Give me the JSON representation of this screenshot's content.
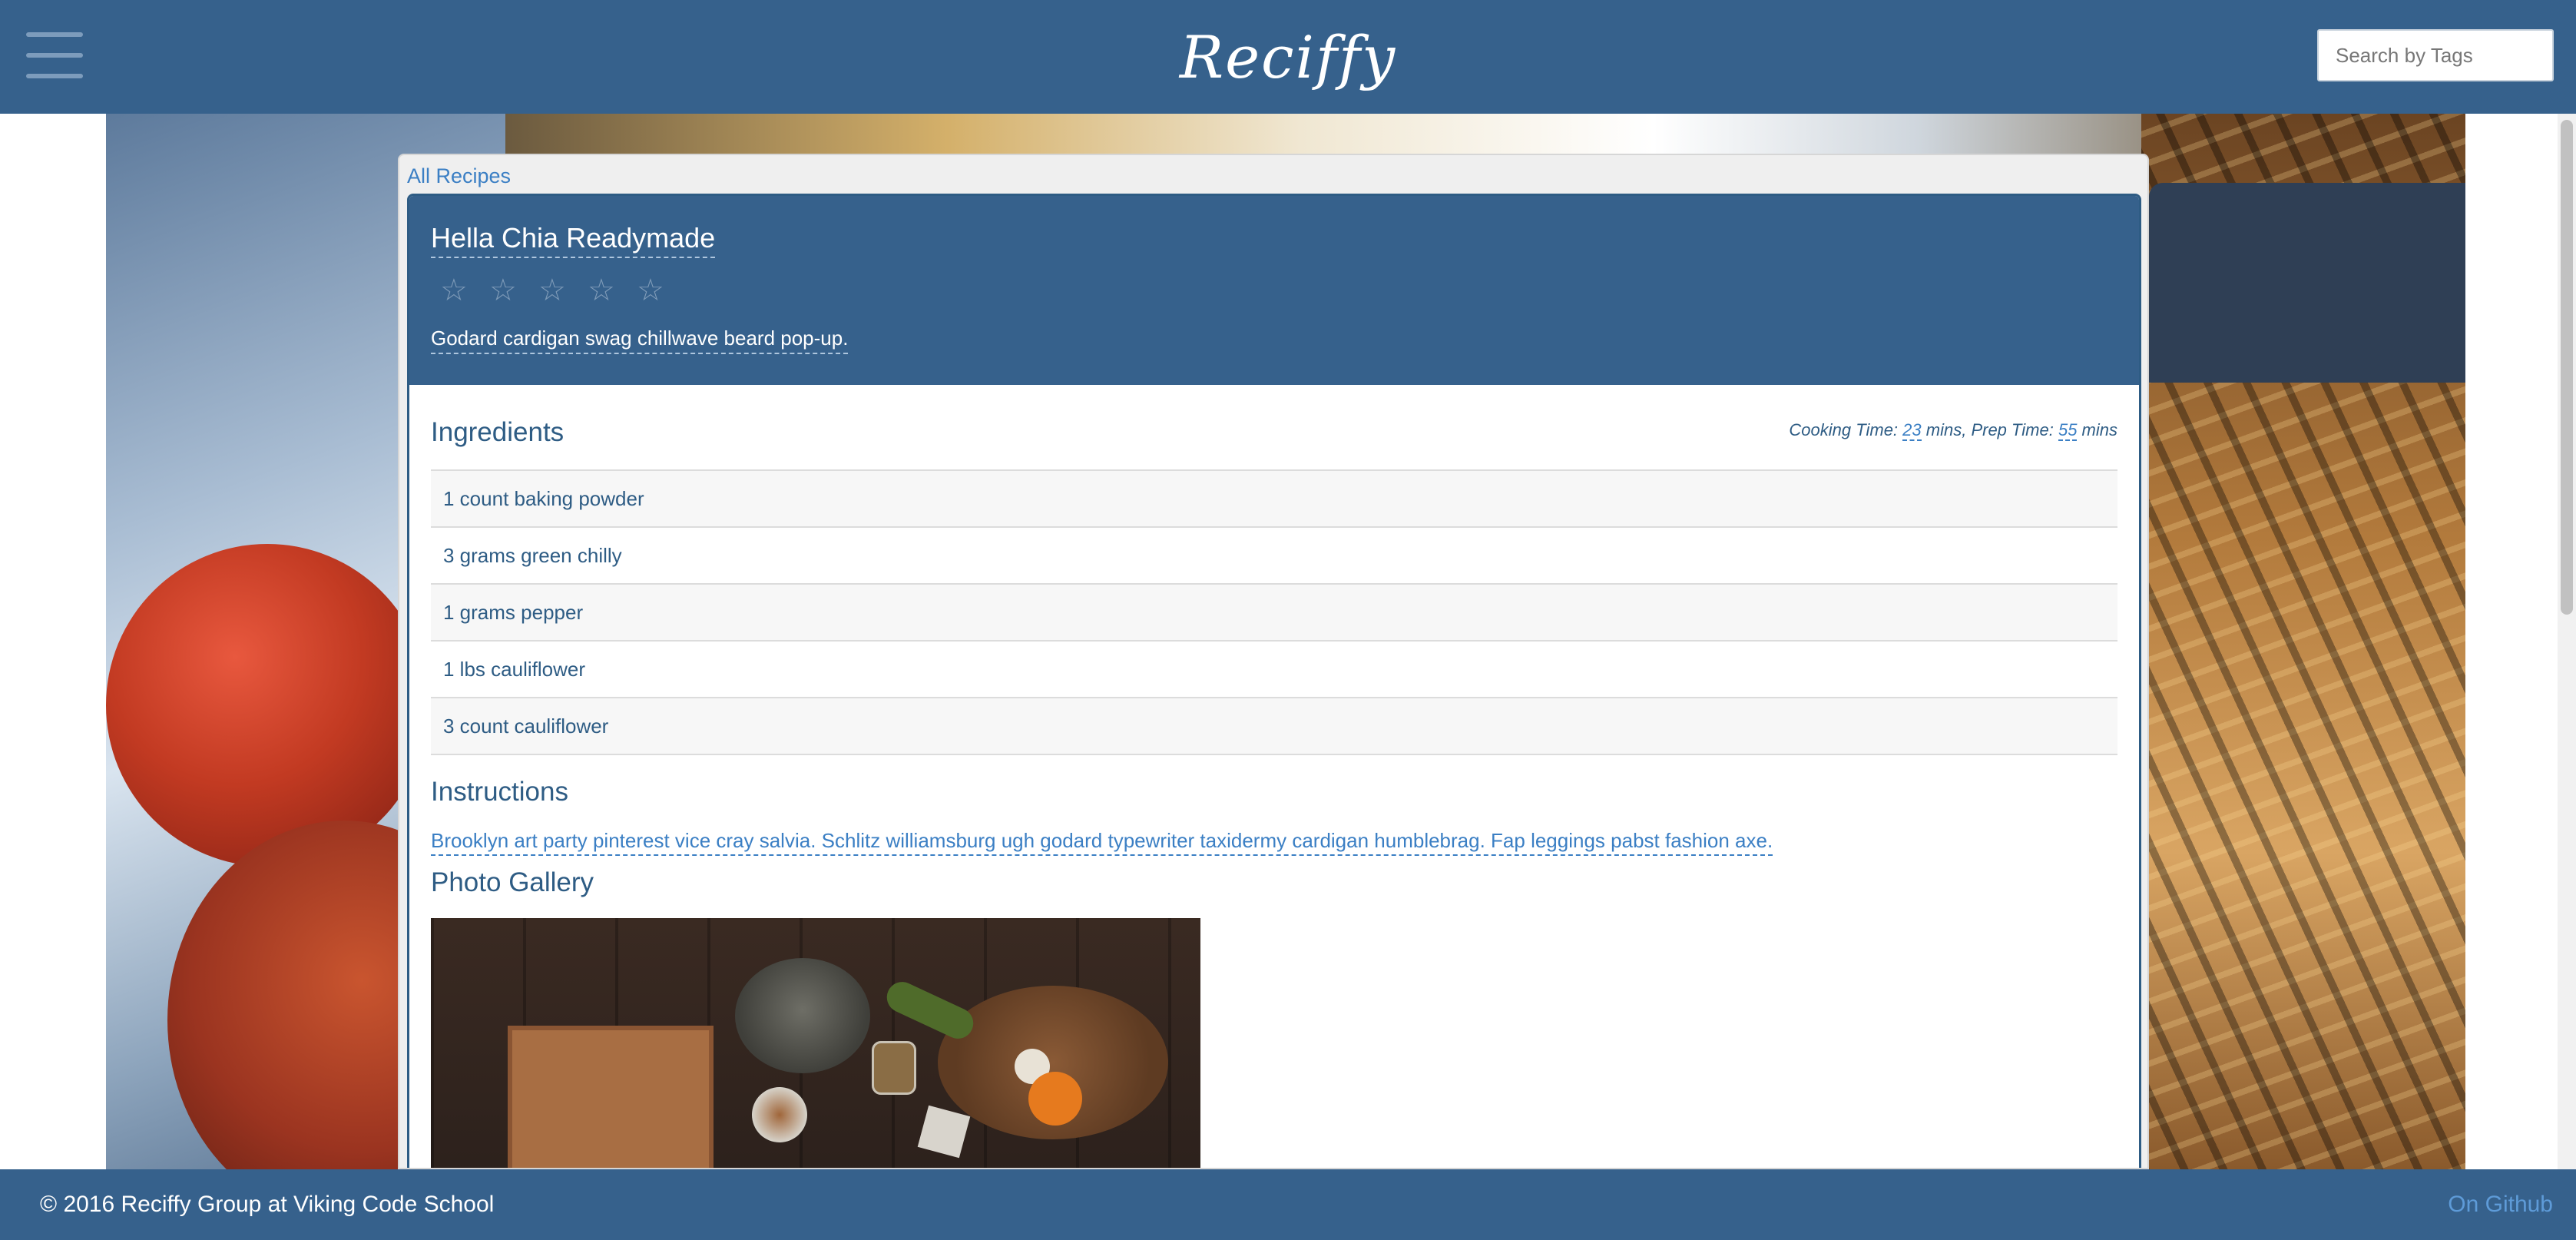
{
  "header": {
    "brand": "Reciffy",
    "search_placeholder": "Search by Tags",
    "menu_icon": "hamburger-menu-icon"
  },
  "breadcrumb": {
    "all_recipes": "All Recipes"
  },
  "recipe": {
    "title": "Hella Chia Readymade",
    "rating": {
      "max": 5,
      "value": 0,
      "star_glyph": "☆"
    },
    "description": "Godard cardigan swag chillwave beard pop-up.",
    "ingredients_heading": "Ingredients",
    "times": {
      "cooking_label": "Cooking Time: ",
      "cooking_value": "23",
      "cooking_unit": " mins, ",
      "prep_label": "Prep Time: ",
      "prep_value": "55",
      "prep_unit": " mins"
    },
    "ingredients": [
      "1 count baking powder",
      "3 grams green chilly",
      "1 grams pepper",
      "1 lbs cauliflower",
      "3 count cauliflower"
    ],
    "instructions_heading": "Instructions",
    "instructions": "Brooklyn art party pinterest vice cray salvia. Schlitz williamsburg ugh godard typewriter taxidermy cardigan humblebrag. Fap leggings pabst fashion axe.",
    "gallery_heading": "Photo Gallery"
  },
  "footer": {
    "copyright": "© 2016 Reciffy Group at Viking Code School",
    "github": "On Github"
  },
  "colors": {
    "navbar": "#36618c",
    "text": "#2e5c84",
    "link": "#3b7fc4"
  }
}
